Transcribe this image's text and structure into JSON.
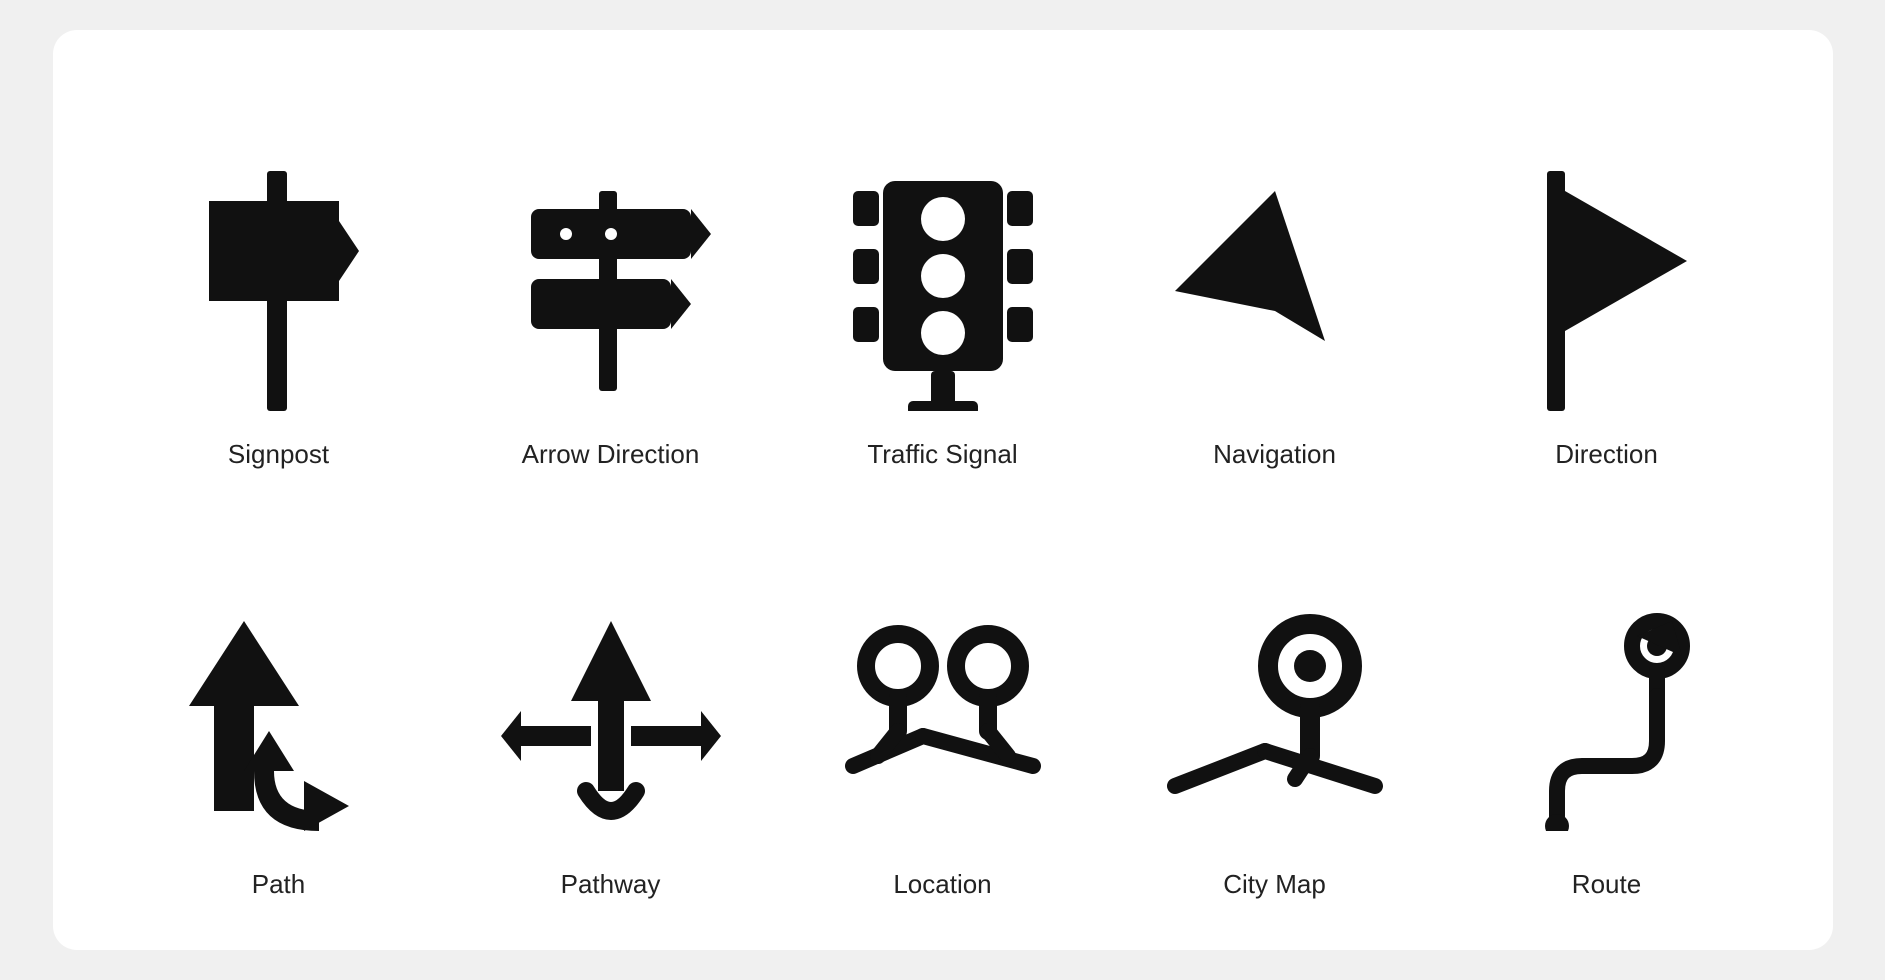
{
  "icons": [
    {
      "id": "signpost",
      "label": "Signpost"
    },
    {
      "id": "arrow-direction",
      "label": "Arrow Direction"
    },
    {
      "id": "traffic-signal",
      "label": "Traffic Signal"
    },
    {
      "id": "navigation",
      "label": "Navigation"
    },
    {
      "id": "direction",
      "label": "Direction"
    },
    {
      "id": "path",
      "label": "Path"
    },
    {
      "id": "pathway",
      "label": "Pathway"
    },
    {
      "id": "location",
      "label": "Location"
    },
    {
      "id": "city-map",
      "label": "City Map"
    },
    {
      "id": "route",
      "label": "Route"
    }
  ]
}
